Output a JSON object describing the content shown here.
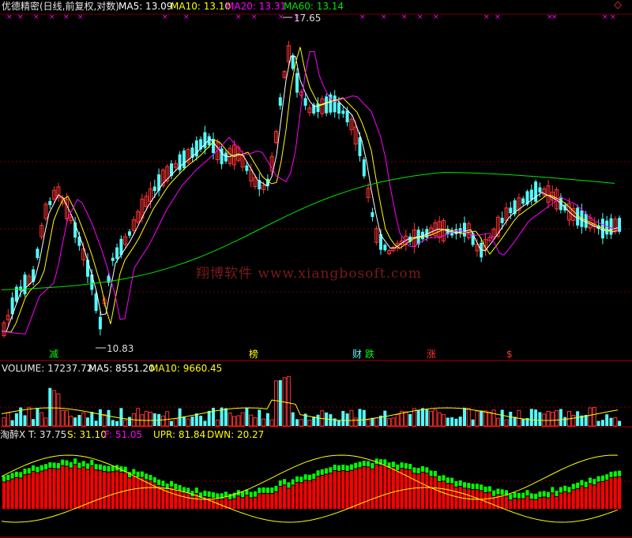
{
  "header": {
    "title": "优德精密(日线,前复权,对数)",
    "ma5": "MA5: 13.09",
    "ma10": "MA10: 13.10",
    "ma20": "MA20: 13.31",
    "ma60": "MA60: 13.14"
  },
  "price_labels": {
    "high": "17.65",
    "low": "10.83"
  },
  "event_tags": [
    "减",
    "榜",
    "财",
    "跌",
    "涨",
    "$"
  ],
  "volume_header": {
    "volume": "VOLUME: 17237.72",
    "ma5": "MA5: 8551.20",
    "ma10": "MA10: 9660.45"
  },
  "indicator_header": {
    "name": "淘醉X",
    "t": "T: 37.75",
    "s": "S: 31.10",
    "f": "F: 51.05",
    "upr": "UPR: 81.84",
    "dwn": "DWN: 20.27"
  },
  "watermark": "翔博软件 www.xiangbosoft.com",
  "corner_marker": "◇",
  "colors": {
    "up": "#ff3232",
    "down": "#54fcfc",
    "ma5": "#ffffff",
    "ma10": "#ffff00",
    "ma20": "#ff00ff",
    "ma60": "#00e600",
    "panel_border": "#b00000",
    "ind_green": "#00ff00",
    "ind_red": "#ff0000"
  }
}
